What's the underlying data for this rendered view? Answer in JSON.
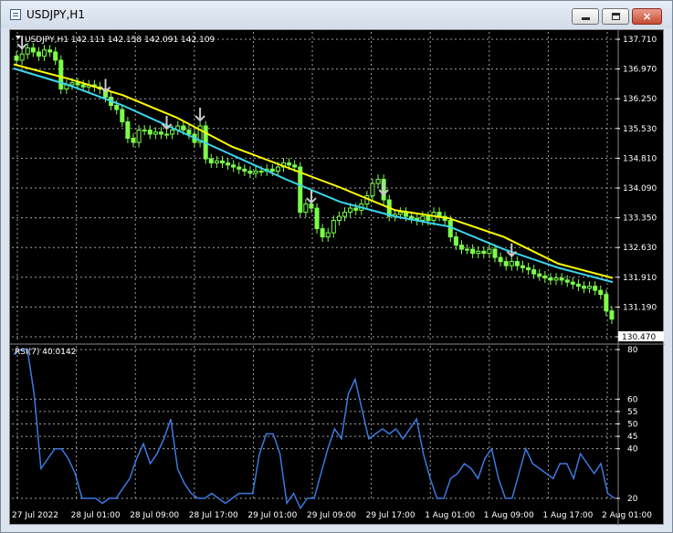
{
  "window": {
    "title": "USDJPY,H1",
    "controls": {
      "minimize": "minimize",
      "maximize": "maximize",
      "close": "×"
    }
  },
  "main_chart": {
    "info_label": "USDJPY,H1  142.111 142.158 142.091 142.109",
    "price_ticks": [
      "137.710",
      "136.970",
      "136.250",
      "135.530",
      "134.810",
      "134.090",
      "133.350",
      "132.630",
      "131.910",
      "131.190",
      "130.470"
    ],
    "current_price": "130.470"
  },
  "rsi": {
    "label": "RSI(7) 40.0142",
    "ticks": [
      "80",
      "60",
      "55",
      "50",
      "45",
      "40",
      "20"
    ]
  },
  "time_axis": [
    "27 Jul 2022",
    "28 Jul 01:00",
    "28 Jul 09:00",
    "28 Jul 17:00",
    "29 Jul 01:00",
    "29 Jul 09:00",
    "29 Jul 17:00",
    "1 Aug 01:00",
    "1 Aug 09:00",
    "1 Aug 17:00",
    "2 Aug 01:00"
  ],
  "colors": {
    "background": "#000000",
    "grid": "#a0a0a0",
    "candle": "#7cff4a",
    "ma_slow": "#ffff00",
    "ma_fast": "#3ad6f0",
    "rsi_line": "#3a7ae0",
    "arrows": "#c8c8c8"
  },
  "chart_data": [
    {
      "type": "candlestick",
      "title": "USDJPY,H1",
      "ylim": [
        130.47,
        137.71
      ],
      "x": [
        "27 Jul 2022",
        "28 Jul 01:00",
        "28 Jul 09:00",
        "28 Jul 17:00",
        "29 Jul 01:00",
        "29 Jul 09:00",
        "29 Jul 17:00",
        "1 Aug 01:00",
        "1 Aug 09:00",
        "1 Aug 17:00",
        "2 Aug 01:00"
      ],
      "close": [
        137.2,
        137.35,
        137.5,
        137.4,
        137.3,
        137.45,
        137.4,
        137.2,
        136.5,
        136.6,
        136.65,
        136.6,
        136.55,
        136.6,
        136.55,
        136.5,
        136.3,
        136.1,
        136.0,
        135.7,
        135.3,
        135.2,
        135.5,
        135.5,
        135.4,
        135.45,
        135.4,
        135.4,
        135.5,
        135.6,
        135.5,
        135.4,
        135.2,
        135.6,
        134.8,
        134.7,
        134.75,
        134.7,
        134.65,
        134.6,
        134.55,
        134.5,
        134.45,
        134.5,
        134.5,
        134.55,
        134.5,
        134.6,
        134.7,
        134.65,
        134.6,
        133.5,
        133.7,
        133.6,
        133.1,
        132.9,
        133.0,
        133.3,
        133.4,
        133.5,
        133.6,
        133.55,
        133.7,
        133.9,
        134.2,
        134.3,
        133.8,
        133.4,
        133.45,
        133.5,
        133.4,
        133.35,
        133.3,
        133.4,
        133.3,
        133.5,
        133.4,
        133.3,
        132.9,
        132.7,
        132.6,
        132.6,
        132.5,
        132.55,
        132.5,
        132.6,
        132.4,
        132.3,
        132.2,
        132.3,
        132.2,
        132.15,
        132.1,
        132.0,
        131.95,
        131.9,
        131.85,
        131.9,
        131.85,
        131.8,
        131.75,
        131.7,
        131.65,
        131.7,
        131.6,
        131.5,
        131.1,
        130.9
      ],
      "ma_slow": [
        137.1,
        136.75,
        136.35,
        135.8,
        135.1,
        134.6,
        134.1,
        133.55,
        133.35,
        132.9,
        132.25,
        131.9
      ],
      "ma_fast": [
        137.0,
        136.6,
        136.1,
        135.5,
        134.9,
        134.3,
        133.75,
        133.4,
        133.15,
        132.6,
        132.15,
        131.8
      ]
    },
    {
      "type": "line",
      "title": "RSI(7) 40.0142",
      "ylim": [
        20,
        80
      ],
      "series": [
        {
          "name": "RSI(7)",
          "values": [
            78,
            80,
            80,
            62,
            32,
            36,
            40,
            40,
            36,
            30,
            20,
            20,
            20,
            18,
            20,
            20,
            24,
            28,
            36,
            42,
            34,
            38,
            44,
            52,
            32,
            26,
            22,
            20,
            20,
            22,
            20,
            18,
            20,
            22,
            22,
            22,
            38,
            46,
            46,
            38,
            18,
            22,
            16,
            20,
            20,
            30,
            40,
            48,
            44,
            62,
            68,
            56,
            44,
            46,
            48,
            46,
            48,
            44,
            48,
            52,
            38,
            28,
            20,
            20,
            28,
            30,
            34,
            32,
            28,
            36,
            40,
            28,
            20,
            20,
            30,
            40,
            34,
            32,
            30,
            28,
            34,
            34,
            28,
            38,
            34,
            30,
            34,
            22,
            20
          ]
        }
      ]
    }
  ]
}
